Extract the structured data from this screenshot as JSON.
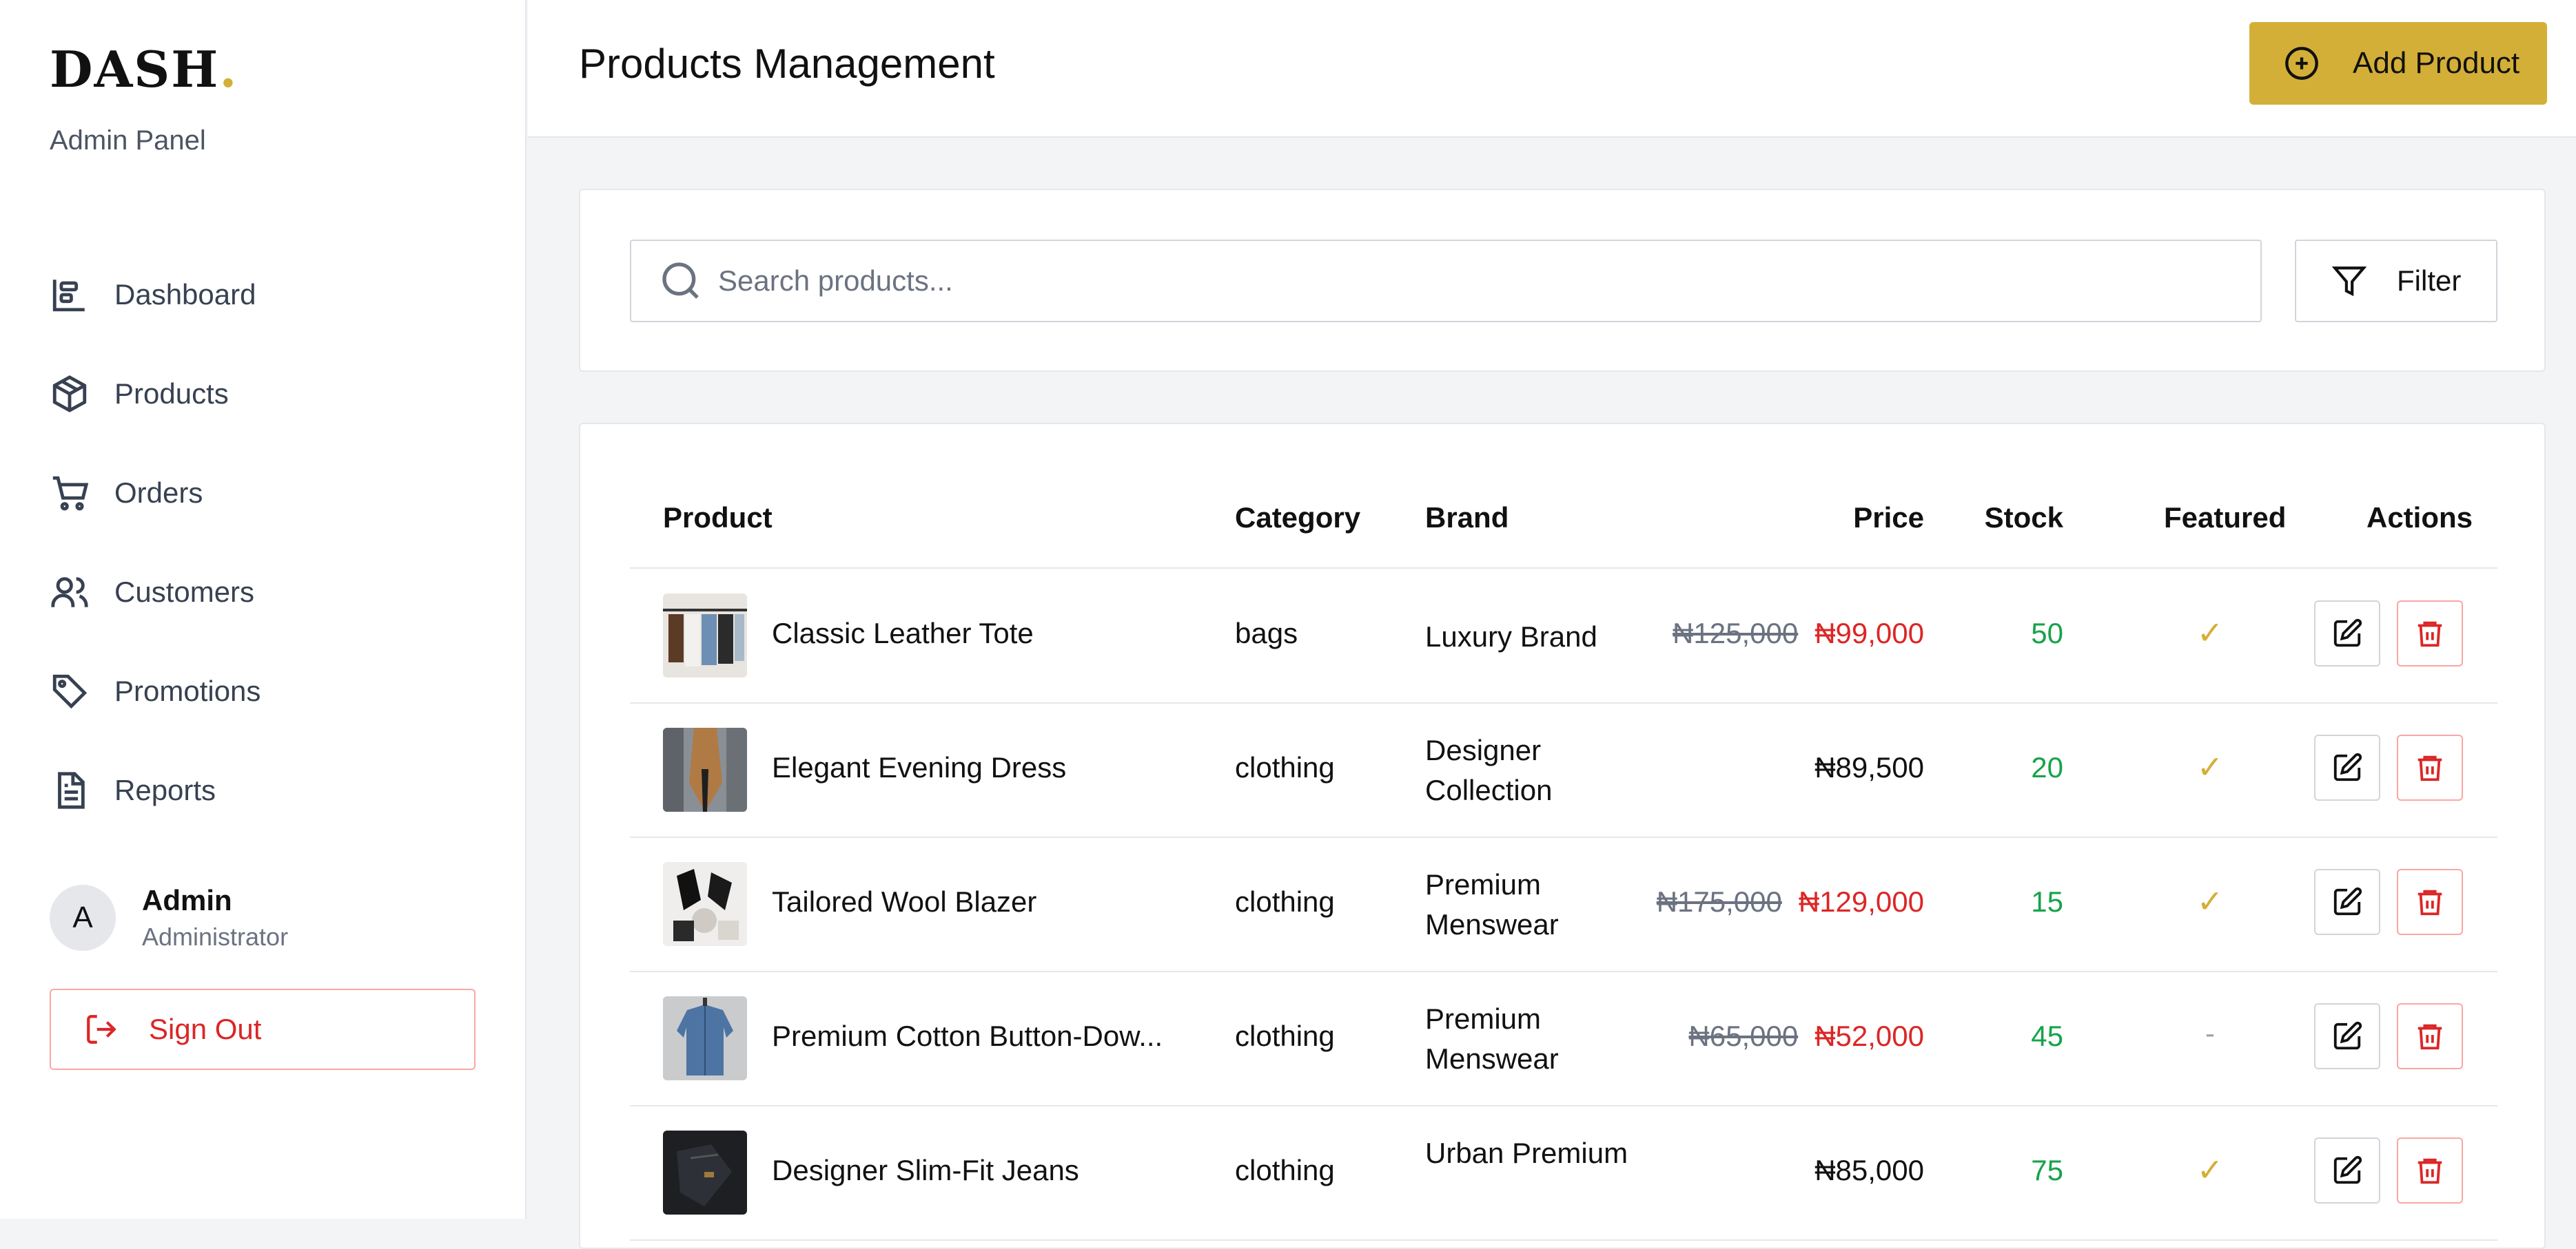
{
  "sidebar": {
    "logo": "DASH",
    "logo_dot": ".",
    "subtitle": "Admin Panel",
    "items": [
      {
        "label": "Dashboard",
        "icon": "dashboard-icon"
      },
      {
        "label": "Products",
        "icon": "box-icon"
      },
      {
        "label": "Orders",
        "icon": "cart-icon"
      },
      {
        "label": "Customers",
        "icon": "users-icon"
      },
      {
        "label": "Promotions",
        "icon": "tag-icon"
      },
      {
        "label": "Reports",
        "icon": "file-icon"
      }
    ],
    "user": {
      "initial": "A",
      "name": "Admin",
      "role": "Administrator"
    },
    "signout_label": "Sign Out"
  },
  "header": {
    "title": "Products Management",
    "add_label": "Add Product"
  },
  "search": {
    "placeholder": "Search products...",
    "value": "",
    "filter_label": "Filter"
  },
  "table": {
    "headers": {
      "product": "Product",
      "category": "Category",
      "brand": "Brand",
      "price": "Price",
      "stock": "Stock",
      "featured": "Featured",
      "actions": "Actions"
    },
    "rows": [
      {
        "name": "Classic Leather Tote",
        "category": "bags",
        "brand": "Luxury Brand",
        "old_price": "₦125,000",
        "price": "₦99,000",
        "stock": "50",
        "featured": "✓"
      },
      {
        "name": "Elegant Evening Dress",
        "category": "clothing",
        "brand": "Designer Collection",
        "old_price": "",
        "price": "₦89,500",
        "stock": "20",
        "featured": "✓"
      },
      {
        "name": "Tailored Wool Blazer",
        "category": "clothing",
        "brand": "Premium Menswear",
        "old_price": "₦175,000",
        "price": "₦129,000",
        "stock": "15",
        "featured": "✓"
      },
      {
        "name": "Premium Cotton Button-Dow...",
        "category": "clothing",
        "brand": "Premium Menswear",
        "old_price": "₦65,000",
        "price": "₦52,000",
        "stock": "45",
        "featured": "-"
      },
      {
        "name": "Designer Slim-Fit Jeans",
        "category": "clothing",
        "brand": "Urban Premium",
        "old_price": "",
        "price": "₦85,000",
        "stock": "75",
        "featured": "✓"
      }
    ]
  },
  "colors": {
    "accent": "#d4af37",
    "danger": "#dc2626",
    "success": "#16a34a"
  }
}
